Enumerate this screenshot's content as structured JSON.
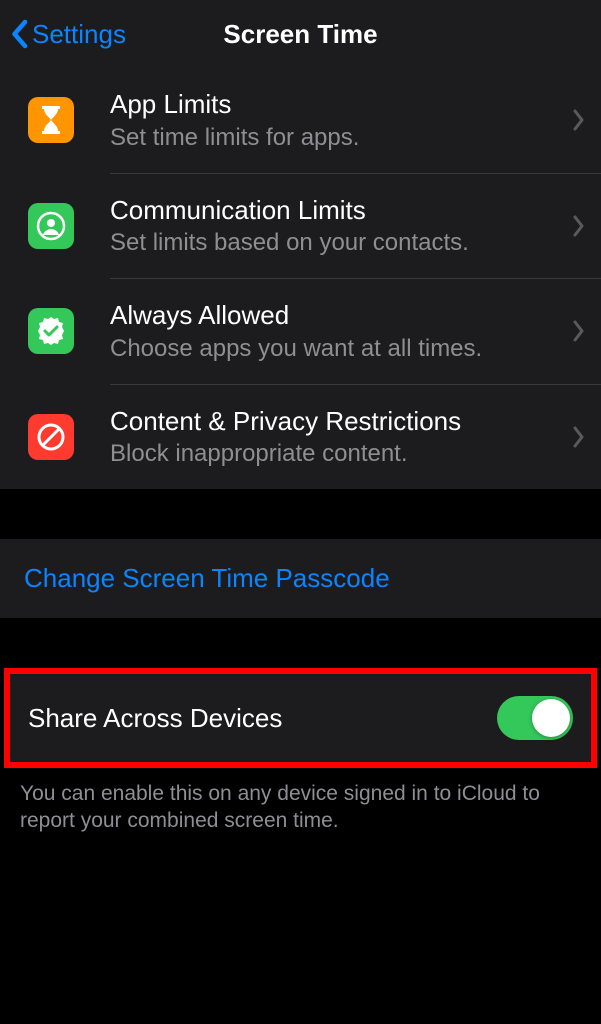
{
  "nav": {
    "back_label": "Settings",
    "title": "Screen Time"
  },
  "rows": [
    {
      "title": "App Limits",
      "subtitle": "Set time limits for apps."
    },
    {
      "title": "Communication Limits",
      "subtitle": "Set limits based on your contacts."
    },
    {
      "title": "Always Allowed",
      "subtitle": "Choose apps you want at all times."
    },
    {
      "title": "Content & Privacy Restrictions",
      "subtitle": "Block inappropriate content."
    }
  ],
  "link": {
    "change_passcode": "Change Screen Time Passcode"
  },
  "toggle": {
    "share_label": "Share Across Devices",
    "share_state": true
  },
  "footer": {
    "text": "You can enable this on any device signed in to iCloud to report your combined screen time."
  }
}
